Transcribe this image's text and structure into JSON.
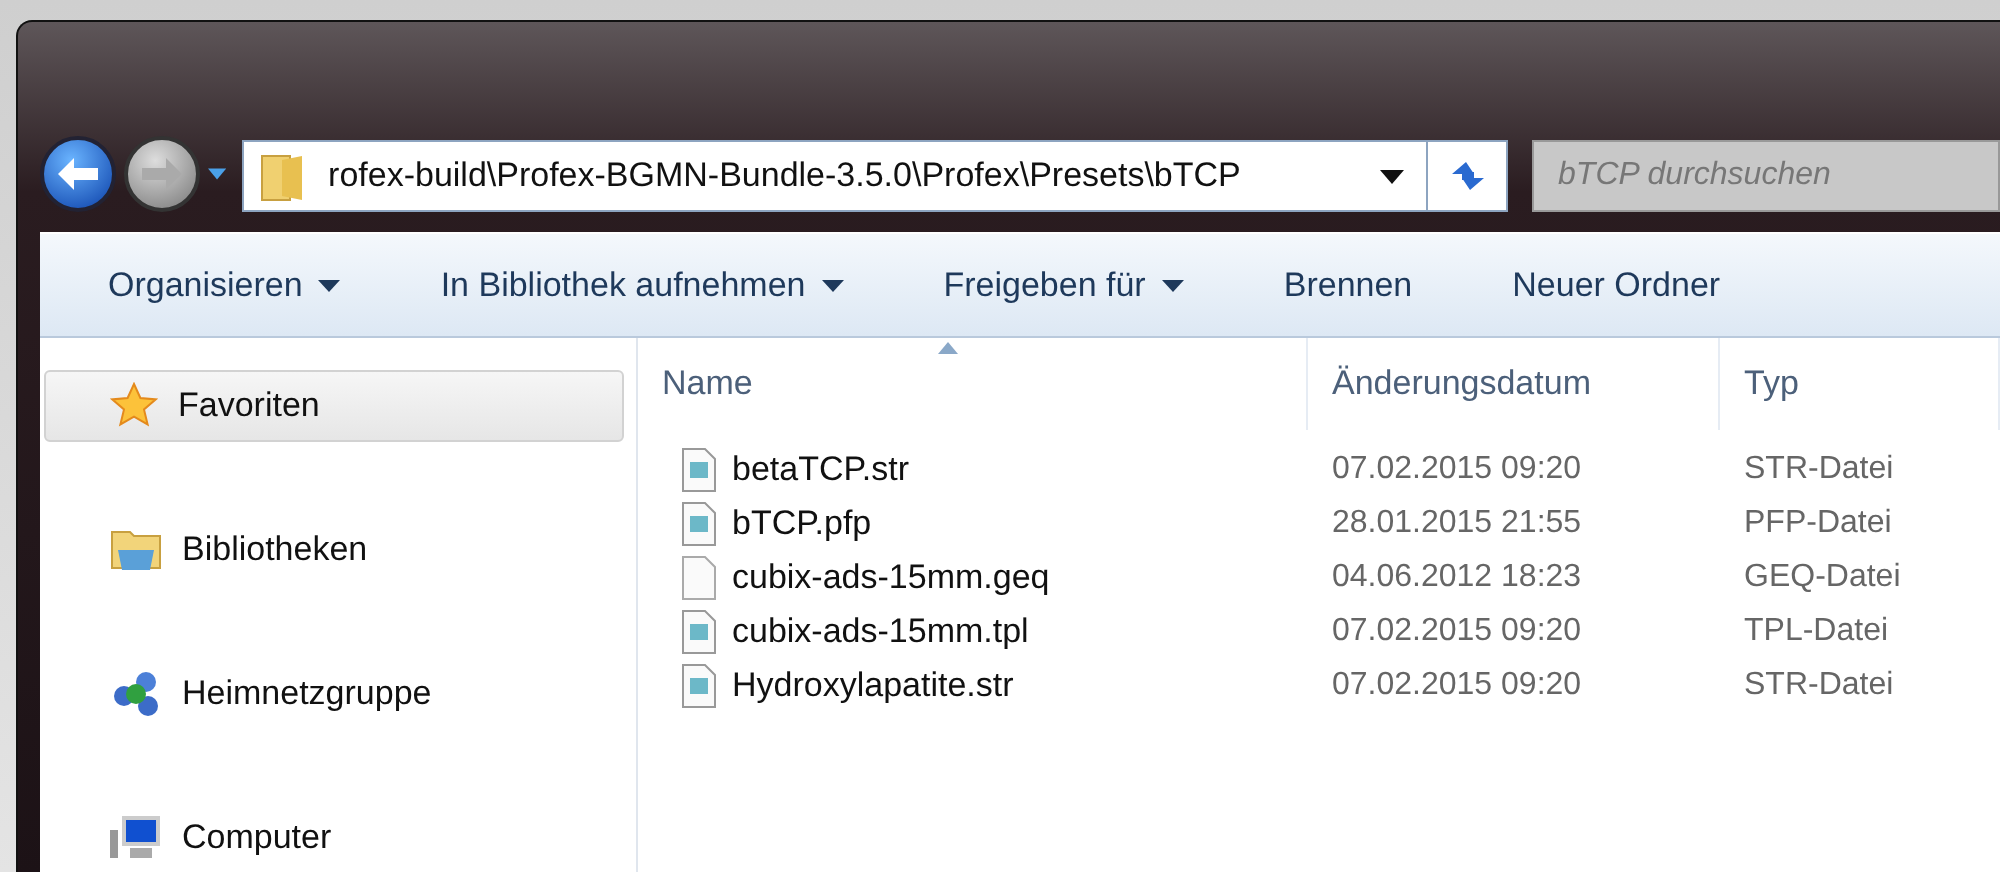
{
  "address_bar": {
    "value": "rofex-build\\Profex-BGMN-Bundle-3.5.0\\Profex\\Presets\\bTCP"
  },
  "search": {
    "placeholder": "bTCP durchsuchen"
  },
  "toolbar": [
    {
      "label": "Organisieren",
      "dropdown": true
    },
    {
      "label": "In Bibliothek aufnehmen",
      "dropdown": true
    },
    {
      "label": "Freigeben für",
      "dropdown": true
    },
    {
      "label": "Brennen",
      "dropdown": false
    },
    {
      "label": "Neuer Ordner",
      "dropdown": false
    }
  ],
  "sidebar": {
    "items": [
      {
        "label": "Favoriten",
        "kind": "star",
        "selected": true
      },
      {
        "label": "Bibliotheken",
        "kind": "library",
        "selected": false
      },
      {
        "label": "Heimnetzgruppe",
        "kind": "homegroup",
        "selected": false
      },
      {
        "label": "Computer",
        "kind": "computer",
        "selected": false
      }
    ]
  },
  "table": {
    "columns": [
      {
        "label": "Name",
        "sorted": true
      },
      {
        "label": "Änderungsdatum",
        "sorted": false
      },
      {
        "label": "Typ",
        "sorted": false
      }
    ],
    "rows": [
      {
        "name": "betaTCP.str",
        "kind": "data",
        "date": "07.02.2015 09:20",
        "type": "STR-Datei"
      },
      {
        "name": "bTCP.pfp",
        "kind": "data",
        "date": "28.01.2015 21:55",
        "type": "PFP-Datei"
      },
      {
        "name": "cubix-ads-15mm.geq",
        "kind": "blank",
        "date": "04.06.2012 18:23",
        "type": "GEQ-Datei"
      },
      {
        "name": "cubix-ads-15mm.tpl",
        "kind": "data",
        "date": "07.02.2015 09:20",
        "type": "TPL-Datei"
      },
      {
        "name": "Hydroxylapatite.str",
        "kind": "data",
        "date": "07.02.2015 09:20",
        "type": "STR-Datei"
      }
    ]
  }
}
